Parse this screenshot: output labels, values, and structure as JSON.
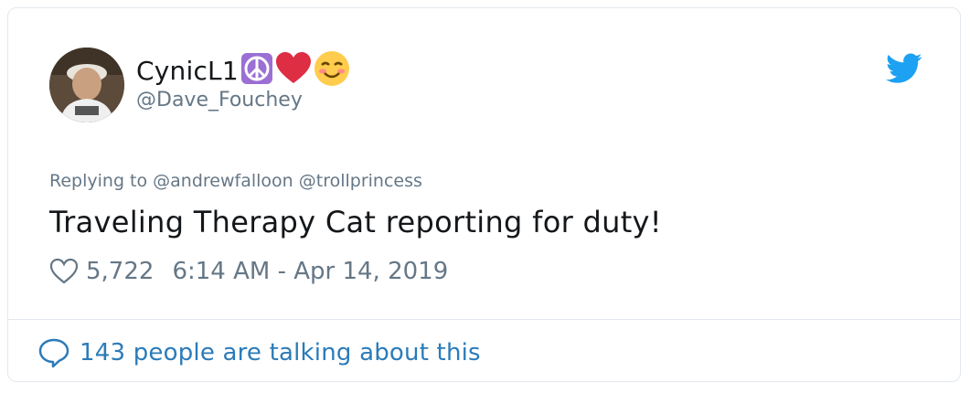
{
  "user": {
    "display_name": "CynicL1",
    "handle": "@Dave_Fouchey",
    "name_emojis": [
      "peace-symbol",
      "red-heart",
      "smiling-face-with-smiling-eyes"
    ]
  },
  "tweet": {
    "reply_context": "Replying to @andrewfalloon @trollprincess",
    "text": "Traveling Therapy Cat reporting for duty!",
    "likes": "5,722",
    "timestamp": "6:14 AM - Apr 14, 2019"
  },
  "footer": {
    "talking_text": "143 people are talking about this"
  },
  "colors": {
    "twitter_blue": "#1da1f2",
    "link_blue": "#2b7bb9",
    "secondary_text": "#657786",
    "border": "#e1e8ed"
  }
}
